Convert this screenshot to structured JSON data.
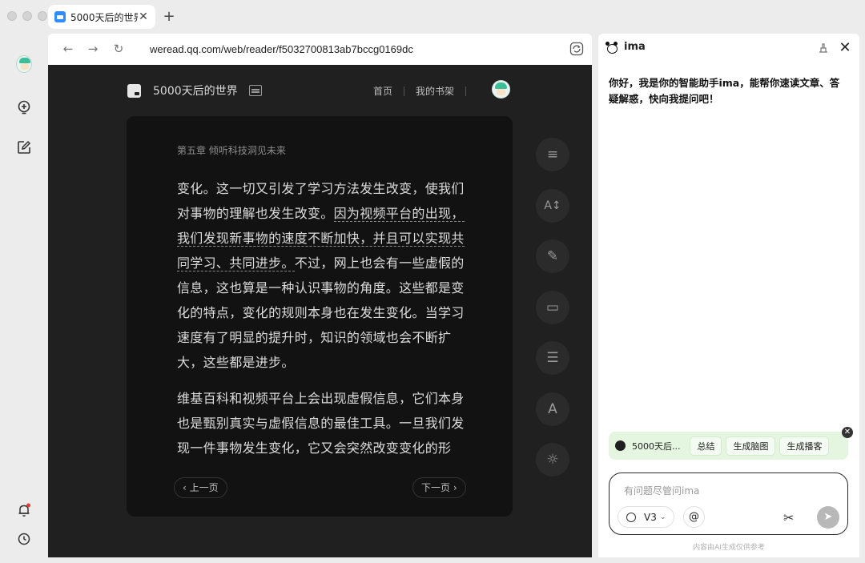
{
  "window": {
    "tab_title": "5000天后的世界",
    "tab_close": "✕",
    "new_tab": "+"
  },
  "leftbar": {
    "icons": [
      "avatar-icon",
      "add-bulb-icon",
      "edit-icon",
      "bell-icon",
      "history-icon"
    ],
    "notification_color": "#e53935"
  },
  "browser": {
    "back": "←",
    "forward": "→",
    "reload": "↻",
    "url": "weread.qq.com/web/reader/f5032700813ab7bccg0169dc"
  },
  "reader": {
    "book_title": "5000天后的世界",
    "nav": {
      "home": "首页",
      "shelf": "我的书架"
    },
    "chapter": "第五章 倾听科技洞见未来",
    "para1": {
      "a": "变化。这一切又引发了学习方法发生改变，使我们对事物的理解也发生改变。",
      "b": "因为视频平台的出现，我们发现新事物的速度不断加快，并且可以实现共同学习、共同进步。",
      "c": "不过，网上也会有一些虚假的信息，这也算是一种认识事物的角度。这些都是变化的特点，变化的规则本身也在发生变化。当学习速度有了明显的提升时，知识的领域也会不断扩大，这些都是进步。"
    },
    "para2": "维基百科和视频平台上会出现虚假信息，它们本身也是甄别真实与虚假信息的最佳工具。一旦我们发现一件事物发生变化，它又会突然改变变化的形",
    "prev": "上一页",
    "next": "下一页",
    "prev_arrow": "‹",
    "next_arrow": "›",
    "tools": [
      "≡",
      "A↕",
      "✎",
      "▭",
      "☰",
      "A",
      "☼"
    ],
    "page_bg": "#121212",
    "reader_bg": "#202020"
  },
  "ima": {
    "name": "ima",
    "close": "✕",
    "greeting": "你好，我是你的智能助手ima，能帮你速读文章、答疑解惑，快向我提问吧！",
    "quick": {
      "doc_title": "5000天后...",
      "chips": [
        "总结",
        "生成脑图",
        "生成播客"
      ],
      "close": "✕"
    },
    "input": {
      "placeholder": "有问题尽管问ima",
      "version": "V3",
      "version_chevron": "⌄",
      "at": "@",
      "scissors": "✂",
      "send": "➤"
    },
    "disclaimer": "内容由AI生成仅供参考",
    "accent_bg": "#e4f5e0"
  }
}
